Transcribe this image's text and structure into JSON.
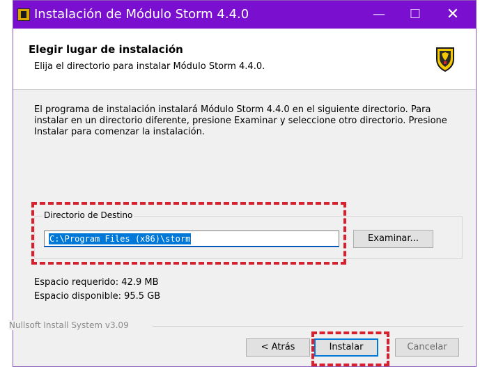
{
  "window": {
    "title": "Instalación de Módulo Storm 4.4.0",
    "controls": {
      "minimize": "—",
      "maximize": "☐",
      "close": "✕"
    },
    "accent": "#7a0fd0"
  },
  "header": {
    "title": "Elegir lugar de instalación",
    "subtitle": "Elija el directorio para instalar Módulo Storm 4.4.0.",
    "icon": "coat-of-arms-icon"
  },
  "body": {
    "description": "El programa de instalación instalará Módulo Storm 4.4.0 en el siguiente directorio. Para instalar en un directorio diferente, presione Examinar y seleccione otro directorio. Presione Instalar para comenzar la instalación."
  },
  "destination": {
    "group_label": "Directorio de Destino",
    "path_value": "C:\\Program Files (x86)\\storm",
    "browse_label": "Examinar..."
  },
  "space": {
    "required": "Espacio requerido: 42.9 MB",
    "available": "Espacio disponible: 95.5 GB"
  },
  "footer": {
    "branding": "Nullsoft Install System v3.09",
    "back_label": "< Atrás",
    "install_label": "Instalar",
    "cancel_label": "Cancelar"
  },
  "highlight_color": "#d9202e"
}
